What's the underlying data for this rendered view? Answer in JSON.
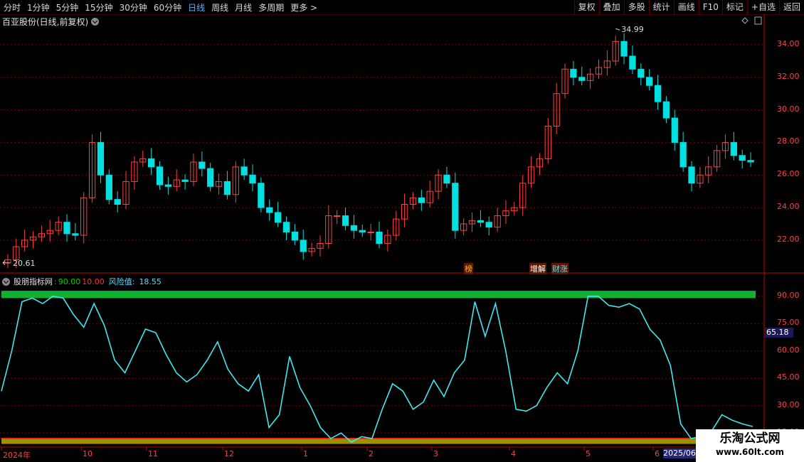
{
  "toolbar": {
    "periods": [
      "分时",
      "1分钟",
      "5分钟",
      "15分钟",
      "30分钟",
      "60分钟",
      "日线",
      "周线",
      "月线",
      "多周期",
      "更多 >"
    ],
    "active_period": "日线",
    "buttons": [
      "复权",
      "叠加",
      "多股",
      "统计",
      "画线",
      "F10",
      "标记",
      "+自选",
      "返回"
    ]
  },
  "stock": {
    "title": "百亚股份(日线,前复权)"
  },
  "price_axis": [
    "34.00",
    "32.00",
    "30.00",
    "28.00",
    "26.00",
    "24.00",
    "22.00"
  ],
  "price_annotations": {
    "high": "34.99",
    "low": "20.61"
  },
  "event_tags": [
    {
      "label": "榜",
      "color": "#ffb020"
    },
    {
      "label": "增解",
      "color": "#ffffff"
    },
    {
      "label": "财涨",
      "color": "#4fe0ff"
    }
  ],
  "indicator": {
    "name": "股朋指标网",
    "sep": ":",
    "v90": "90.00",
    "v10": "10.00",
    "risk_label": "风险值:",
    "risk_value": "18.55",
    "axis": [
      "90.00",
      "75.00",
      "60.00",
      "45.00",
      "30.00",
      "15.00"
    ],
    "current": "65.18"
  },
  "x_axis": [
    "2024年",
    "10",
    "11",
    "12",
    "1",
    "2",
    "3",
    "4",
    "5",
    "6"
  ],
  "current_date": "2025/06",
  "watermark": {
    "title": "乐淘公式网",
    "url": "www.60lt.com"
  },
  "colors": {
    "up": "#ff4040",
    "down": "#00e0e0",
    "risk_line": "#40e8f0",
    "upper_band": "#10b030",
    "lower_band": "#a09000",
    "grid": "#7a0000"
  },
  "chart_data": [
    {
      "type": "candlestick",
      "title": "百亚股份(日线,前复权)",
      "ylim": [
        20.6,
        35.0
      ],
      "y_ticks": [
        22,
        24,
        26,
        28,
        30,
        32,
        34
      ],
      "x_ticks": [
        "2024年",
        "10",
        "11",
        "12",
        "1",
        "2",
        "3",
        "4",
        "5",
        "6"
      ],
      "approx_close": [
        20.8,
        21.6,
        22.0,
        22.2,
        22.4,
        22.6,
        23.1,
        22.4,
        22.3,
        24.6,
        28.0,
        26.0,
        24.5,
        24.2,
        25.6,
        26.8,
        27.0,
        26.5,
        25.4,
        25.3,
        25.7,
        25.6,
        26.8,
        26.4,
        25.3,
        25.6,
        24.8,
        26.5,
        26.0,
        25.5,
        24.0,
        23.7,
        23.1,
        22.5,
        22.0,
        21.3,
        21.5,
        21.8,
        23.5,
        23.5,
        22.9,
        22.6,
        22.5,
        22.5,
        21.8,
        22.3,
        23.3,
        24.2,
        24.6,
        24.3,
        25.0,
        26.0,
        25.5,
        22.6,
        23.0,
        23.2,
        23.1,
        22.8,
        23.5,
        23.8,
        24.0,
        25.5,
        26.5,
        27.0,
        29.0,
        31.0,
        32.5,
        32.0,
        31.8,
        32.2,
        32.6,
        33.0,
        34.2,
        33.3,
        32.5,
        32.0,
        31.5,
        30.5,
        29.5,
        28.0,
        26.5,
        25.5,
        26.0,
        26.5,
        27.5,
        28.0,
        27.2,
        26.9,
        26.8
      ]
    },
    {
      "type": "line",
      "series": [
        {
          "name": "风险值",
          "values": [
            38,
            60,
            87,
            89,
            86,
            90,
            89,
            80,
            73,
            86,
            74,
            55,
            48,
            60,
            72,
            70,
            58,
            48,
            43,
            47,
            55,
            65,
            50,
            42,
            38,
            47,
            18,
            25,
            57,
            40,
            30,
            18,
            12,
            15,
            10,
            13,
            12,
            28,
            42,
            38,
            28,
            32,
            44,
            35,
            48,
            55,
            87,
            68,
            86,
            60,
            28,
            27,
            30,
            40,
            48,
            42,
            60,
            90,
            90,
            85,
            84,
            86,
            83,
            72,
            66,
            52,
            20,
            12,
            13,
            16,
            25,
            22,
            20,
            18.55
          ]
        }
      ],
      "ylim": [
        10,
        95
      ],
      "y_ticks": [
        15,
        30,
        45,
        60,
        75,
        90
      ],
      "bands": [
        90,
        10
      ]
    }
  ]
}
